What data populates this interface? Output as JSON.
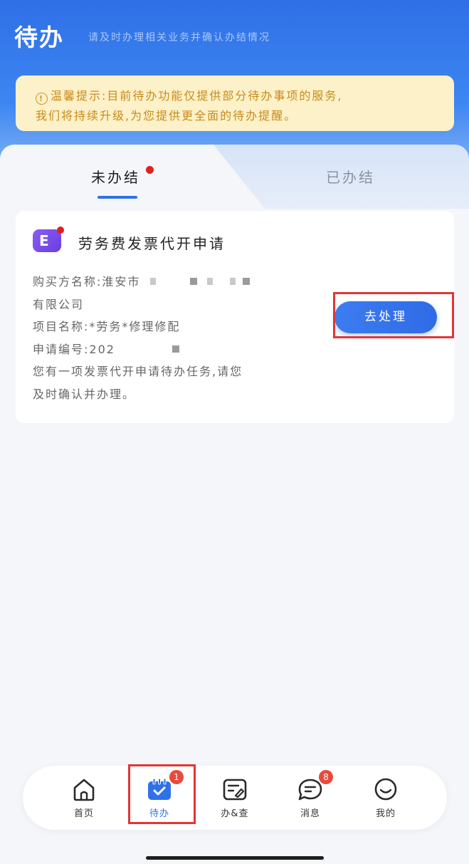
{
  "header": {
    "title": "待办",
    "subtitle": "请及时办理相关业务并确认办结情况"
  },
  "notice": {
    "label": "温馨提示:",
    "line1": "目前待办功能仅提供部分待办事项的服务,",
    "line2": "我们将持续升级,为您提供更全面的待办提醒。"
  },
  "tabs": [
    {
      "label": "未办结",
      "active": true,
      "has_dot": true
    },
    {
      "label": "已办结",
      "active": false
    }
  ],
  "card": {
    "title": "劳务费发票代开申请",
    "buyer_label": "购买方名称:",
    "buyer_value_visible": "淮安市",
    "buyer_value_line2": "有限公司",
    "project_label": "项目名称:",
    "project_value": "*劳务*修理修配",
    "apply_no_label": "申请编号:",
    "apply_no_value_visible": "202",
    "description_line1": "您有一项发票代开申请待办任务,请您",
    "description_line2": "及时确认并办理。",
    "action_label": "去处理"
  },
  "tabbar": {
    "items": [
      {
        "label": "首页",
        "icon": "home-icon",
        "active": false
      },
      {
        "label": "待办",
        "icon": "calendar-check-icon",
        "active": true,
        "badge": "1"
      },
      {
        "label": "办&查",
        "icon": "edit-form-icon",
        "active": false
      },
      {
        "label": "消息",
        "icon": "message-icon",
        "active": false,
        "badge": "8"
      },
      {
        "label": "我的",
        "icon": "smile-icon",
        "active": false
      }
    ]
  },
  "colors": {
    "primary": "#2f72e8",
    "notice_bg": "#fdf1c9",
    "notice_text": "#c98a1a",
    "badge": "#e84a3c",
    "highlight": "#e03636"
  }
}
